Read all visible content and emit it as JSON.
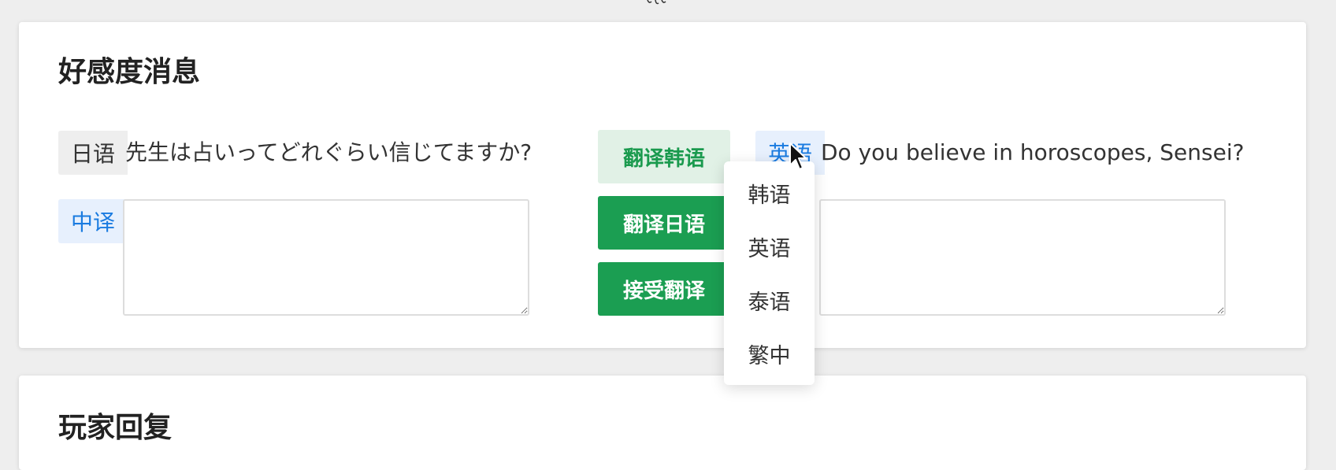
{
  "favor_section": {
    "title": "好感度消息",
    "source": {
      "lang_tag": "日语",
      "text": "先生は占いってどれぐらい信じてますか?"
    },
    "translation_left": {
      "lang_tag": "中译",
      "value": ""
    },
    "buttons": {
      "translate_korean": "翻译韩语",
      "translate_japanese": "翻译日语",
      "accept_translation": "接受翻译"
    },
    "translation_right": {
      "lang_tag": "英语",
      "text": "Do you believe in horoscopes, Sensei?",
      "value": ""
    },
    "language_dropdown": {
      "options": [
        "韩语",
        "英语",
        "泰语",
        "繁中"
      ]
    }
  },
  "reply_section": {
    "title": "玩家回复"
  },
  "colors": {
    "accent_green": "#1b9e52",
    "accent_green_light": "#e1f1e6",
    "accent_blue": "#1a7be0",
    "tag_blue_bg": "#e7f0fd"
  },
  "icons": {
    "cursor": "mouse-pointer-icon"
  }
}
